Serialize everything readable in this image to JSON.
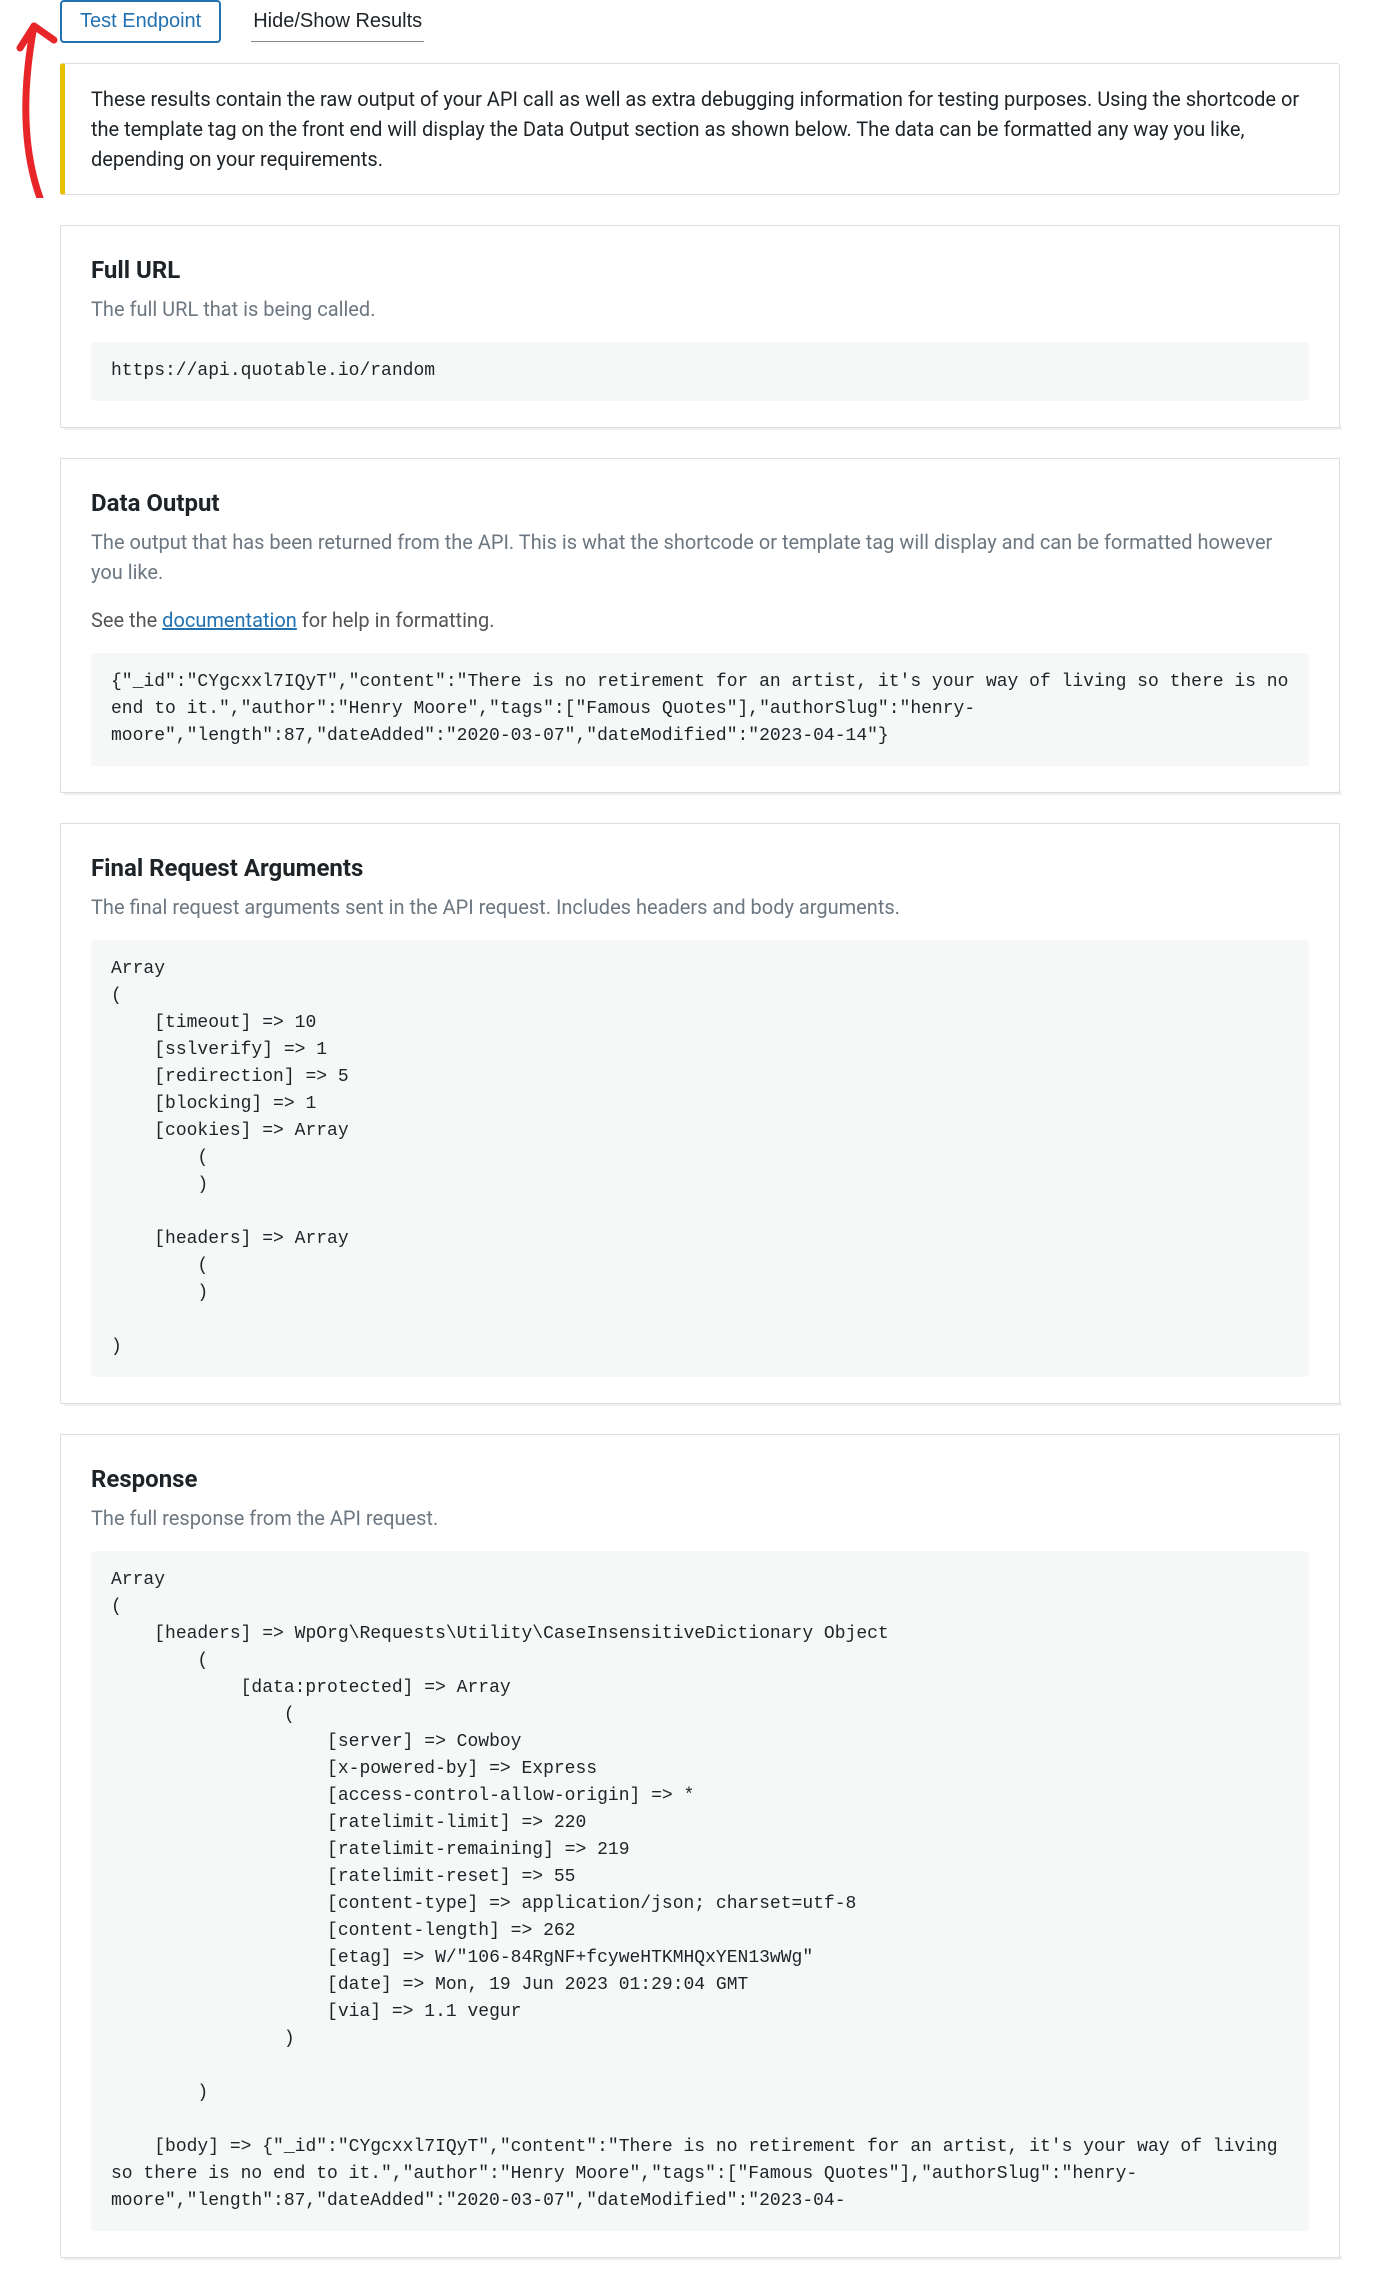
{
  "tabs": {
    "test_endpoint": "Test Endpoint",
    "hide_show": "Hide/Show Results"
  },
  "info": "These results contain the raw output of your API call as well as extra debugging information for testing purposes. Using the shortcode or the template tag on the front end will display the Data Output section as shown below. The data can be formatted any way you like, depending on your requirements.",
  "full_url": {
    "title": "Full URL",
    "sub": "The full URL that is being called.",
    "value": "https://api.quotable.io/random"
  },
  "data_output": {
    "title": "Data Output",
    "sub": "The output that has been returned from the API. This is what the shortcode or template tag will display and can be formatted however you like.",
    "helper_prefix": "See the ",
    "helper_link": "documentation",
    "helper_suffix": " for help in formatting.",
    "value": "{\"_id\":\"CYgcxxl7IQyT\",\"content\":\"There is no retirement for an artist, it's your way of living so there is no end to it.\",\"author\":\"Henry Moore\",\"tags\":[\"Famous Quotes\"],\"authorSlug\":\"henry-moore\",\"length\":87,\"dateAdded\":\"2020-03-07\",\"dateModified\":\"2023-04-14\"}"
  },
  "final_request": {
    "title": "Final Request Arguments",
    "sub": "The final request arguments sent in the API request. Includes headers and body arguments.",
    "value": "Array\n(\n    [timeout] => 10\n    [sslverify] => 1\n    [redirection] => 5\n    [blocking] => 1\n    [cookies] => Array\n        (\n        )\n\n    [headers] => Array\n        (\n        )\n\n)"
  },
  "response": {
    "title": "Response",
    "sub": "The full response from the API request.",
    "value": "Array\n(\n    [headers] => WpOrg\\Requests\\Utility\\CaseInsensitiveDictionary Object\n        (\n            [data:protected] => Array\n                (\n                    [server] => Cowboy\n                    [x-powered-by] => Express\n                    [access-control-allow-origin] => *\n                    [ratelimit-limit] => 220\n                    [ratelimit-remaining] => 219\n                    [ratelimit-reset] => 55\n                    [content-type] => application/json; charset=utf-8\n                    [content-length] => 262\n                    [etag] => W/\"106-84RgNF+fcyweHTKMHQxYEN13wWg\"\n                    [date] => Mon, 19 Jun 2023 01:29:04 GMT\n                    [via] => 1.1 vegur\n                )\n\n        )\n\n    [body] => {\"_id\":\"CYgcxxl7IQyT\",\"content\":\"There is no retirement for an artist, it's your way of living so there is no end to it.\",\"author\":\"Henry Moore\",\"tags\":[\"Famous Quotes\"],\"authorSlug\":\"henry-moore\",\"length\":87,\"dateAdded\":\"2020-03-07\",\"dateModified\":\"2023-04-"
  }
}
